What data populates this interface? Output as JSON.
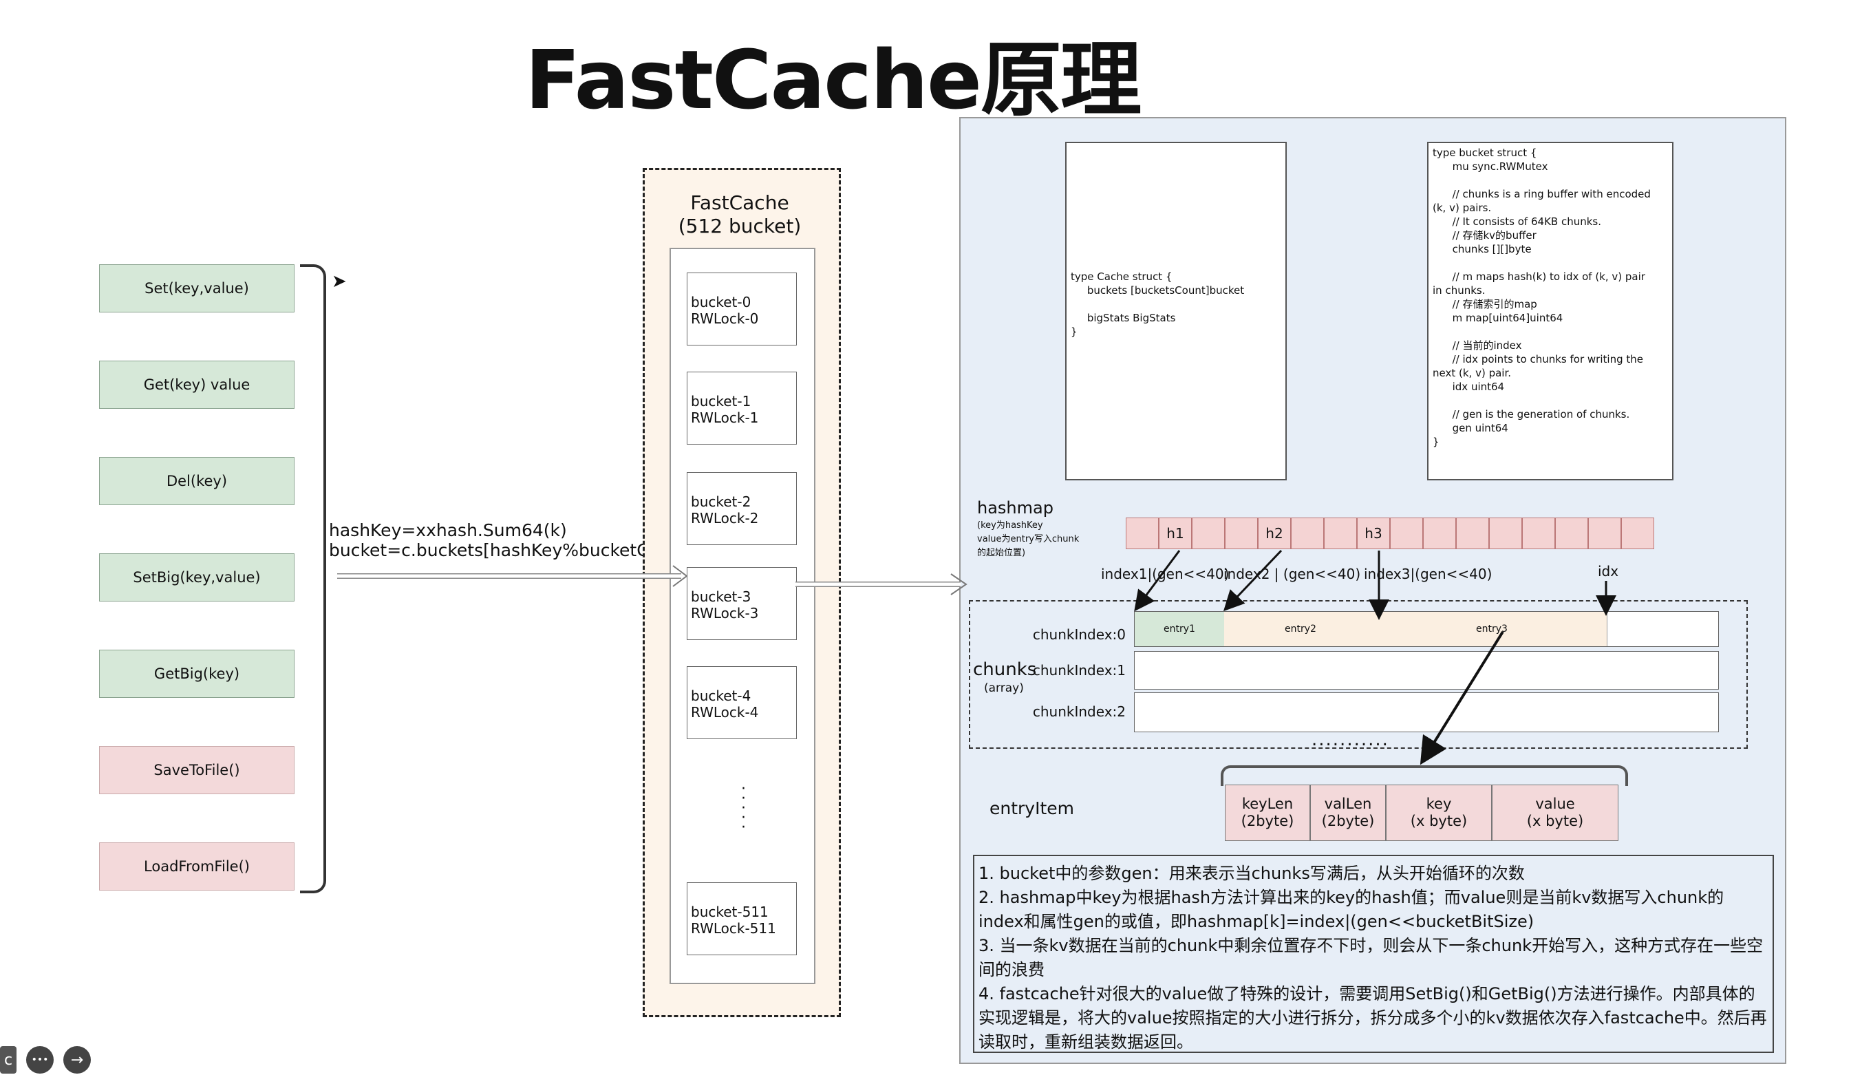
{
  "title": "FastCache原理",
  "api": {
    "set": "Set(key,value)",
    "get": "Get(key) value",
    "del": "Del(key)",
    "setbig": "SetBig(key,value)",
    "getbig": "GetBig(key)",
    "save": "SaveToFile()",
    "load": "LoadFromFile()"
  },
  "hash_text": "hashKey=xxhash.Sum64(k)\nbucket=c.buckets[hashKey%bucketCnt]",
  "fastcache": {
    "title_line1": "FastCache",
    "title_line2": "(512 bucket)",
    "buckets": [
      "bucket-0\nRWLock-0",
      "bucket-1\nRWLock-1",
      "bucket-2\nRWLock-2",
      "bucket-3\nRWLock-3",
      "bucket-4\nRWLock-4",
      "bucket-511\nRWLock-511"
    ]
  },
  "code": {
    "cache_struct": "type Cache struct {\n     buckets [bucketsCount]bucket\n\n     bigStats BigStats\n}",
    "bucket_struct": "type bucket struct {\n      mu sync.RWMutex\n\n      // chunks is a ring buffer with encoded\n(k, v) pairs.\n      // It consists of 64KB chunks.\n      // 存储kv的buffer\n      chunks [][]byte\n\n      // m maps hash(k) to idx of (k, v) pair\nin chunks.\n      // 存储索引的map\n      m map[uint64]uint64\n\n      // 当前的index\n      // idx points to chunks for writing the\nnext (k, v) pair.\n      idx uint64\n\n      // gen is the generation of chunks.\n      gen uint64\n}"
  },
  "hashmap": {
    "label": "hashmap",
    "sub": "(key为hashKey\nvalue为entry写入chunk\n的起始位置)",
    "slots": [
      "",
      "h1",
      "",
      "",
      "h2",
      "",
      "",
      "h3",
      "",
      "",
      "",
      "",
      "",
      "",
      "",
      ""
    ],
    "index_labels": [
      "index1|(gen<<40)",
      "index2 | (gen<<40)",
      "index3|(gen<<40)",
      "idx"
    ]
  },
  "chunks": {
    "label": "chunks",
    "sub": "(array)",
    "rows": [
      "chunkIndex:0",
      "chunkIndex:1",
      "chunkIndex:2"
    ],
    "entries": [
      "entry1",
      "entry2",
      "entry3"
    ],
    "dots": "..........."
  },
  "entryitem": {
    "label": "entryItem",
    "fields": [
      "keyLen\n(2byte)",
      "valLen\n(2byte)",
      "key\n(x byte)",
      "value\n(x byte)"
    ]
  },
  "notes": [
    "1. bucket中的参数gen：用来表示当chunks写满后，从头开始循环的次数",
    "2. hashmap中key为根据hash方法计算出来的key的hash值；而value则是当前kv数据写入chunk的index和属性gen的或值，即hashmap[k]=index|(gen<<bucketBitSize)",
    "3. 当一条kv数据在当前的chunk中剩余位置存不下时，则会从下一条chunk开始写入，这种方式存在一些空间的浪费",
    "4. fastcache针对很大的value做了特殊的设计，需要调用SetBig()和GetBig()方法进行操作。内部具体的实现逻辑是，将大的value按照指定的大小进行拆分，拆分成多个小的kv数据依次存入fastcache中。然后再读取时，重新组装数据返回。"
  ],
  "controls": {
    "c_label": "c",
    "more": "•••",
    "next": "→"
  }
}
